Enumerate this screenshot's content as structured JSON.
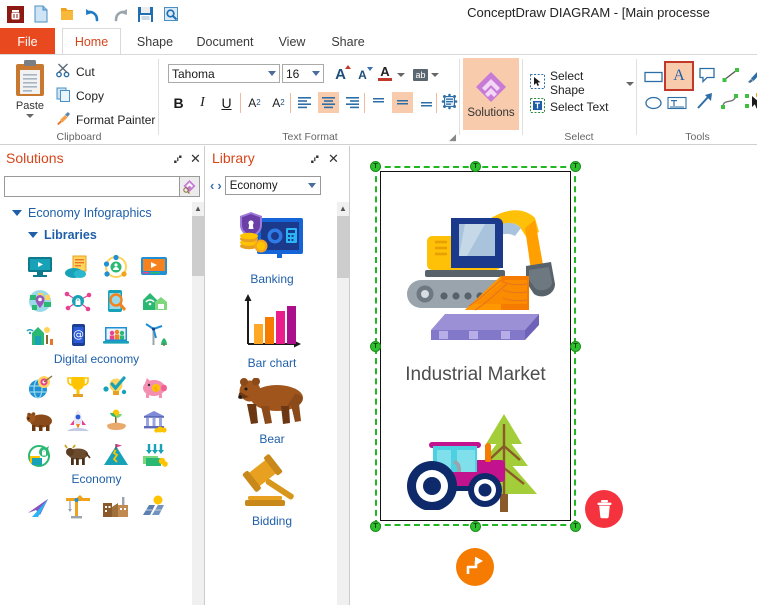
{
  "window": {
    "title": "ConceptDraw DIAGRAM - [Main processe"
  },
  "quick_access": [
    {
      "name": "app-logo-icon",
      "label": "ConceptDraw"
    },
    {
      "name": "new-document-icon",
      "label": "New"
    },
    {
      "name": "open-folder-icon",
      "label": "Open"
    },
    {
      "name": "undo-icon",
      "label": "Undo"
    },
    {
      "name": "redo-icon",
      "label": "Redo"
    },
    {
      "name": "save-icon",
      "label": "Save"
    },
    {
      "name": "print-preview-icon",
      "label": "Print Preview"
    }
  ],
  "ribbon": {
    "tabs": [
      {
        "label": "File",
        "active": false
      },
      {
        "label": "Home",
        "active": true
      },
      {
        "label": "Shape",
        "active": false
      },
      {
        "label": "Document",
        "active": false
      },
      {
        "label": "View",
        "active": false
      },
      {
        "label": "Share",
        "active": false
      }
    ],
    "clipboard": {
      "group_label": "Clipboard",
      "paste_label": "Paste",
      "cut_label": "Cut",
      "copy_label": "Copy",
      "format_painter_label": "Format Painter"
    },
    "text_format": {
      "group_label": "Text Format",
      "font_family": "Tahoma",
      "font_size": "16",
      "grow_font_label": "A",
      "shrink_font_label": "A",
      "font_color_label": "A",
      "highlight_label": "ab",
      "bold_label": "B",
      "italic_label": "I",
      "underline_label": "U",
      "superscript_label": "A",
      "superscript_sup": "2",
      "subscript_label": "A",
      "subscript_sub": "2",
      "align_left": "align-left",
      "align_center": "align-center",
      "align_right": "align-right",
      "valign_top": "valign-top",
      "valign_middle": "valign-middle",
      "valign_bottom": "valign-bottom",
      "text_block_label": "text-block",
      "active_align": "center",
      "active_valign": "middle"
    },
    "solutions": {
      "button_label": "Solutions"
    },
    "select": {
      "group_label": "Select",
      "select_shape_label": "Select Shape",
      "select_text_label": "Select Text"
    },
    "tools": {
      "group_label": "Tools",
      "items": [
        {
          "name": "rectangle-tool-icon",
          "selected": false
        },
        {
          "name": "text-tool-icon",
          "label": "A",
          "selected": true
        },
        {
          "name": "callout-tool-icon",
          "selected": false
        },
        {
          "name": "line-tool-icon",
          "selected": false
        },
        {
          "name": "pen-tool-icon",
          "selected": false
        },
        {
          "name": "ellipse-tool-icon",
          "selected": false
        },
        {
          "name": "text-block-tool-icon",
          "selected": false
        },
        {
          "name": "arrow-tool-icon",
          "selected": false
        },
        {
          "name": "curve-tool-icon",
          "selected": false
        },
        {
          "name": "pointer-tool-icon",
          "selected": false
        }
      ]
    }
  },
  "solutions_panel": {
    "title": "Solutions",
    "pin_label": "⑇",
    "close_label": "✕",
    "search_value": "",
    "search_placeholder": "",
    "search_icon_name": "solutions-search-icon",
    "tree": [
      {
        "label": "Economy Infographics",
        "level": 0,
        "expanded": true
      },
      {
        "label": "Libraries",
        "level": 1,
        "expanded": true,
        "bold": true
      }
    ],
    "groups": [
      {
        "name": "Digital economy"
      },
      {
        "name": "Economy"
      },
      {
        "name": ""
      }
    ]
  },
  "library_panel": {
    "title": "Library",
    "pin_label": "⑇",
    "close_label": "✕",
    "prev_label": "‹",
    "next_label": "›",
    "selected_library": "Economy",
    "items": [
      {
        "label": "Banking",
        "icon": "banking-safe-icon"
      },
      {
        "label": "Bar chart",
        "icon": "bar-chart-icon"
      },
      {
        "label": "Bear",
        "icon": "bear-icon"
      },
      {
        "label": "Bidding",
        "icon": "gavel-icon"
      }
    ]
  },
  "canvas": {
    "shape_label": "Industrial Market",
    "shape_icons": [
      "excavator-lumber-icon",
      "tractor-icon",
      "pine-tree-icon"
    ],
    "handle_glyph": "T",
    "fab_connector_name": "add-connector-button",
    "fab_delete_name": "delete-shape-button"
  },
  "colors": {
    "accent_orange": "#E8491E",
    "tab_active_text": "#D64519",
    "ribbon_highlight": "#F8CBAD",
    "tool_selected_border": "#C0392B",
    "selection_green": "#22b722",
    "fab_orange": "#F57C00",
    "fab_red": "#F5333F",
    "tree_blue": "#1F5FA9"
  }
}
